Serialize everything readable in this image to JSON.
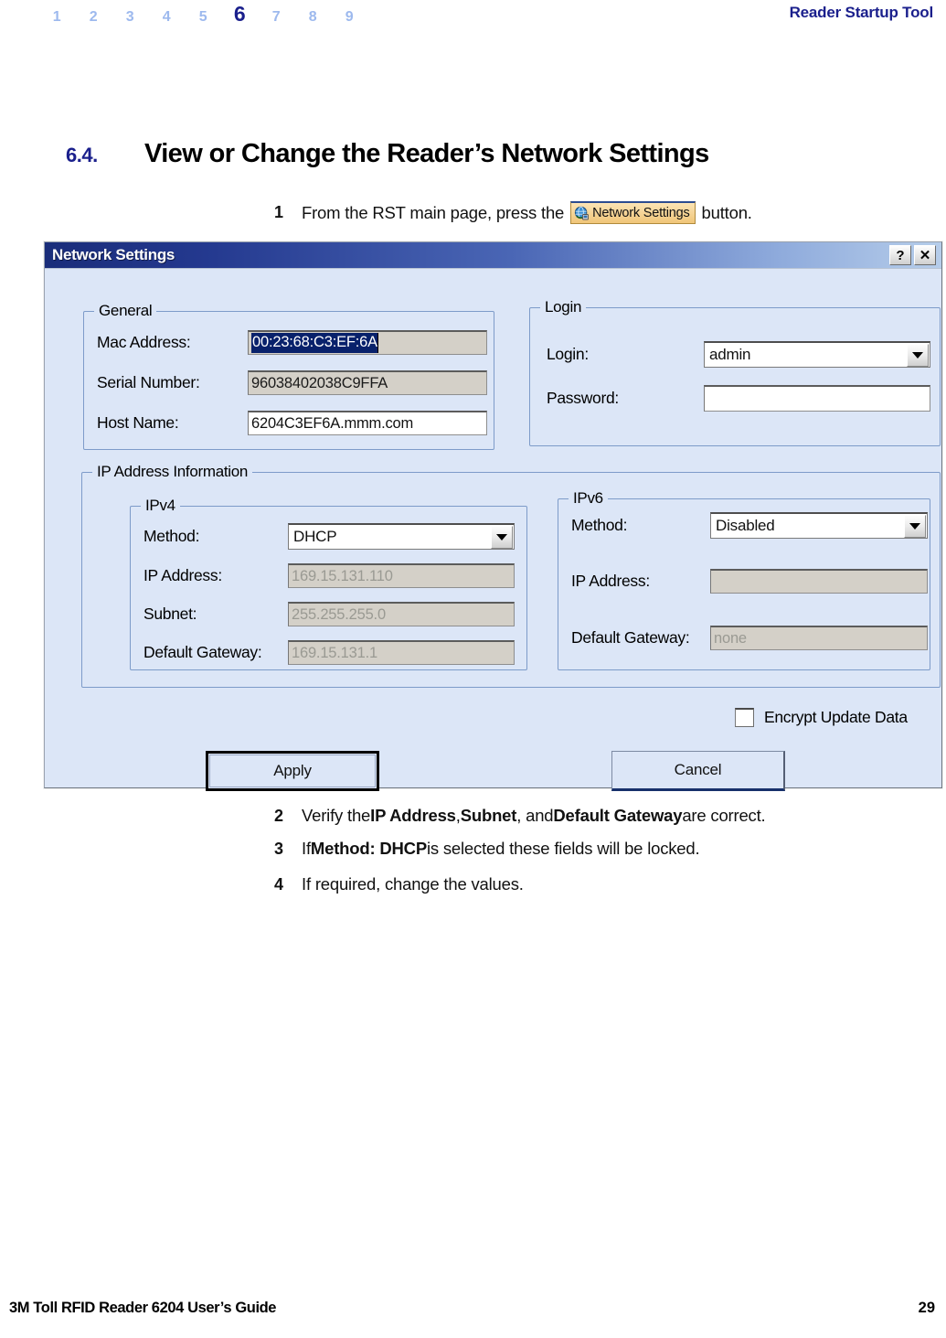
{
  "header": {
    "chapter_numbers": [
      "1",
      "2",
      "3",
      "4",
      "5",
      "6",
      "7",
      "8",
      "9"
    ],
    "active_chapter": "6",
    "title": "Reader Startup Tool",
    "accent_color": "#1a1f8c",
    "inactive_color": "#9db9ee"
  },
  "section": {
    "number": "6.4.",
    "title": "View or Change the Reader’s Network Settings"
  },
  "steps": {
    "step1": {
      "num": "1",
      "before": "From the RST main page, press the",
      "button_label": "Network Settings",
      "button_icon": "globe-network-icon",
      "after": "button."
    },
    "step2": {
      "num": "2",
      "p1": "Verify the ",
      "b1": "IP Address",
      "p2": ", ",
      "b2": "Subnet",
      "p3": ", and ",
      "b3": "Default Gateway",
      "p4": " are correct."
    },
    "step3": {
      "num": "3",
      "p1": "If ",
      "b1": "Method: DHCP",
      "p2": " is selected these fields will be locked."
    },
    "step4": {
      "num": "4",
      "p1": "If required, change the values."
    }
  },
  "dialog": {
    "title": "Network Settings",
    "help_button": "?",
    "close_button": "✕",
    "general": {
      "legend": "General",
      "fields": [
        {
          "label": "Mac Address:",
          "value": "00:23:68:C3:EF:6A",
          "state": "disabled-selected"
        },
        {
          "label": "Serial Number:",
          "value": "96038402038C9FFA",
          "state": "disabled"
        },
        {
          "label": "Host Name:",
          "value": "6204C3EF6A.mmm.com",
          "state": "editable"
        }
      ]
    },
    "login": {
      "legend": "Login",
      "login_label": "Login:",
      "login_value": "admin",
      "password_label": "Password:",
      "password_value": ""
    },
    "ip_info": {
      "legend": "IP Address Information",
      "ipv4": {
        "legend": "IPv4",
        "method_label": "Method:",
        "method_value": "DHCP",
        "ip_label": "IP Address:",
        "ip_value": "169.15.131.110",
        "subnet_label": "Subnet:",
        "subnet_value": "255.255.255.0",
        "gateway_label": "Default Gateway:",
        "gateway_value": "169.15.131.1"
      },
      "ipv6": {
        "legend": "IPv6",
        "method_label": "Method:",
        "method_value": "Disabled",
        "ip_label": "IP Address:",
        "ip_value": "",
        "gateway_label": "Default Gateway:",
        "gateway_value": "none"
      }
    },
    "encrypt_checkbox": {
      "label": "Encrypt Update Data",
      "checked": false
    },
    "buttons": {
      "apply": "Apply",
      "cancel": "Cancel"
    },
    "colors": {
      "titlebar_start": "#1a2d7a",
      "titlebar_end": "#b6cdea",
      "dialog_bg": "#dce6f7",
      "disabled_field": "#d4d0c8",
      "selection": "#08216b"
    }
  },
  "footer": {
    "text": "3M Toll RFID Reader 6204 User’s Guide",
    "page": "29"
  }
}
